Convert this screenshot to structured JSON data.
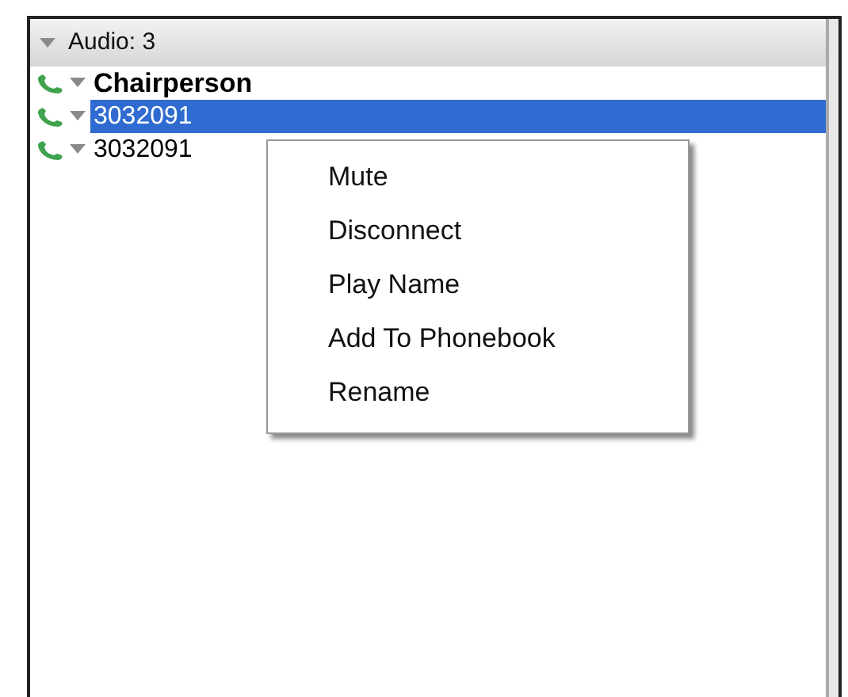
{
  "group": {
    "label": "Audio: 3",
    "expanded": true
  },
  "participants": [
    {
      "kind": "chair",
      "name": "Chairperson",
      "selected": false
    },
    {
      "kind": "line",
      "name": "3032091",
      "selected": true
    },
    {
      "kind": "line",
      "name": "3032091",
      "selected": false
    }
  ],
  "context_menu": [
    "Mute",
    "Disconnect",
    "Play Name",
    "Add To Phonebook",
    "Rename"
  ]
}
